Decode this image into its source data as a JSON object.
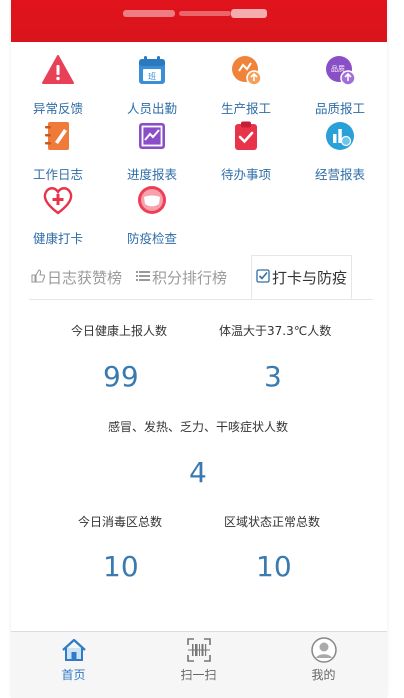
{
  "colors": {
    "brand_red": "#e1131c",
    "link_blue": "#2f6ea8",
    "number_blue": "#3a7ab0",
    "nav_active": "#2f7cc4"
  },
  "shortcuts": [
    {
      "label": "异常反馈",
      "icon": "warning-triangle-icon"
    },
    {
      "label": "人员出勤",
      "icon": "calendar-shift-icon"
    },
    {
      "label": "生产报工",
      "icon": "production-report-icon"
    },
    {
      "label": "品质报工",
      "icon": "quality-report-icon"
    },
    {
      "label": "工作日志",
      "icon": "notebook-icon"
    },
    {
      "label": "进度报表",
      "icon": "trend-chart-icon"
    },
    {
      "label": "待办事项",
      "icon": "clipboard-check-icon"
    },
    {
      "label": "经营报表",
      "icon": "business-chart-icon"
    },
    {
      "label": "健康打卡",
      "icon": "heart-plus-icon"
    },
    {
      "label": "防疫检查",
      "icon": "mask-icon"
    }
  ],
  "tabs": [
    {
      "label": "日志获赞榜",
      "icon": "thumbs-up-icon"
    },
    {
      "label": "积分排行榜",
      "icon": "list-icon"
    },
    {
      "label": "打卡与防疫",
      "icon": "checkbox-icon"
    }
  ],
  "active_tab": "打卡与防疫",
  "stats": {
    "health_report": {
      "label": "今日健康上报人数",
      "value": "99"
    },
    "fever": {
      "label": "体温大于37.3℃人数",
      "value": "3"
    },
    "symptoms": {
      "label": "感冒、发热、乏力、干咳症状人数",
      "value": "4"
    },
    "disinfected": {
      "label": "今日消毒区总数",
      "value": "10"
    },
    "normal_zones": {
      "label": "区域状态正常总数",
      "value": "10"
    }
  },
  "bottom_nav": [
    {
      "label": "首页",
      "icon": "home-icon"
    },
    {
      "label": "扫一扫",
      "icon": "scan-icon"
    },
    {
      "label": "我的",
      "icon": "user-icon"
    }
  ]
}
